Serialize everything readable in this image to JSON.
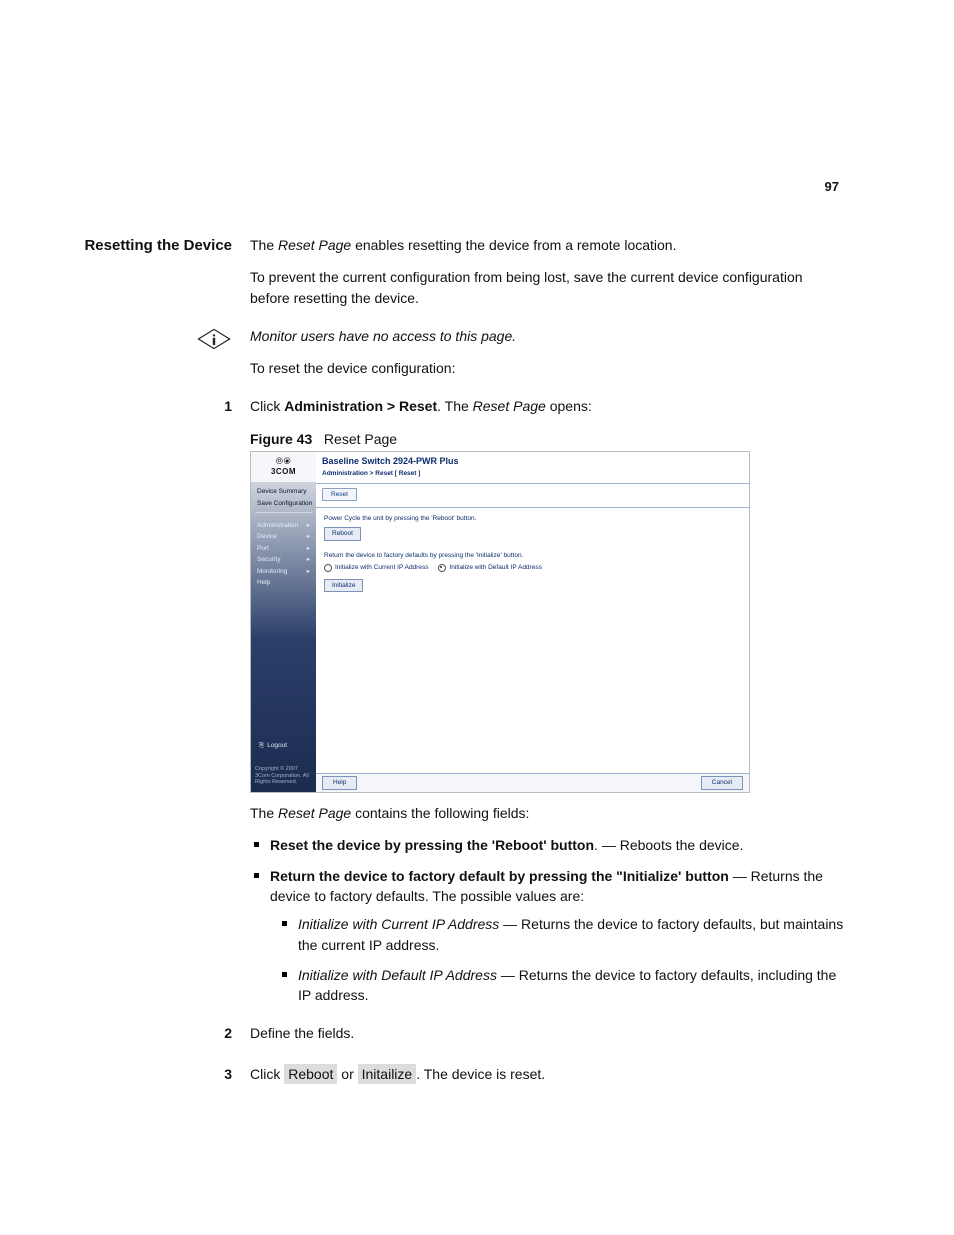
{
  "page_number": "97",
  "section_heading": "Resetting the Device",
  "intro": {
    "p1_a": "The ",
    "p1_b_italic": "Reset Page",
    "p1_c": " enables resetting the device from a remote location.",
    "p2": "To prevent the current configuration from being lost, save the current device configuration before resetting the device.",
    "note_italic": "Monitor users have no access to this page.",
    "p3": "To reset the device configuration:"
  },
  "step1": {
    "num": "1",
    "a": "Click ",
    "b_bold": "Administration > Reset",
    "c": ". The ",
    "d_italic": "Reset Page",
    "e": " opens:"
  },
  "figure": {
    "label": "Figure 43",
    "caption": "Reset Page"
  },
  "screenshot": {
    "logo": "3COM",
    "title": "Baseline Switch 2924-PWR Plus",
    "breadcrumb": "Administration > Reset [ Reset ]",
    "tab": "Reset",
    "nav_top": [
      "Device Summary",
      "Save Configuration"
    ],
    "nav": [
      "Administration",
      "Device",
      "Port",
      "Security",
      "Monitoring",
      "Help"
    ],
    "text1": "Power Cycle the unit by pressing the 'Reboot' button.",
    "btn_reboot": "Reboot",
    "text2": "Return the device to factory defaults by pressing the 'Initialize' button.",
    "radio1": "Initialize with Current IP Address",
    "radio2": "Initialize with Default IP Address",
    "btn_initialize": "Initialize",
    "logout": "Logout",
    "copyright": "Copyright © 2007\n3Com Corporation.\nAll Rights Reserved.",
    "btn_help": "Help",
    "btn_cancel": "Cancel"
  },
  "fields_intro": {
    "a": "The ",
    "b_italic": "Reset Page",
    "c": " contains the following fields:"
  },
  "bullets": {
    "b1_bold": "Reset the device by pressing the 'Reboot' button",
    "b1_rest": ". — Reboots the device.",
    "b2_bold": "Return the device to factory default by pressing the \"Initialize' button",
    "b2_rest": " — Returns the device to factory defaults. The possible values are:",
    "s1_italic": "Initialize with Current IP Address",
    "s1_rest": " — Returns the device to factory defaults, but maintains the current IP address.",
    "s2_italic": "Initialize with Default IP Address",
    "s2_rest": " — Returns the device to factory defaults, including the IP address."
  },
  "step2": {
    "num": "2",
    "text": "Define the fields."
  },
  "step3": {
    "num": "3",
    "a": "Click ",
    "btn1": "Reboot",
    "b": " or ",
    "btn2": "Initailize",
    "c": ". The device is reset."
  }
}
